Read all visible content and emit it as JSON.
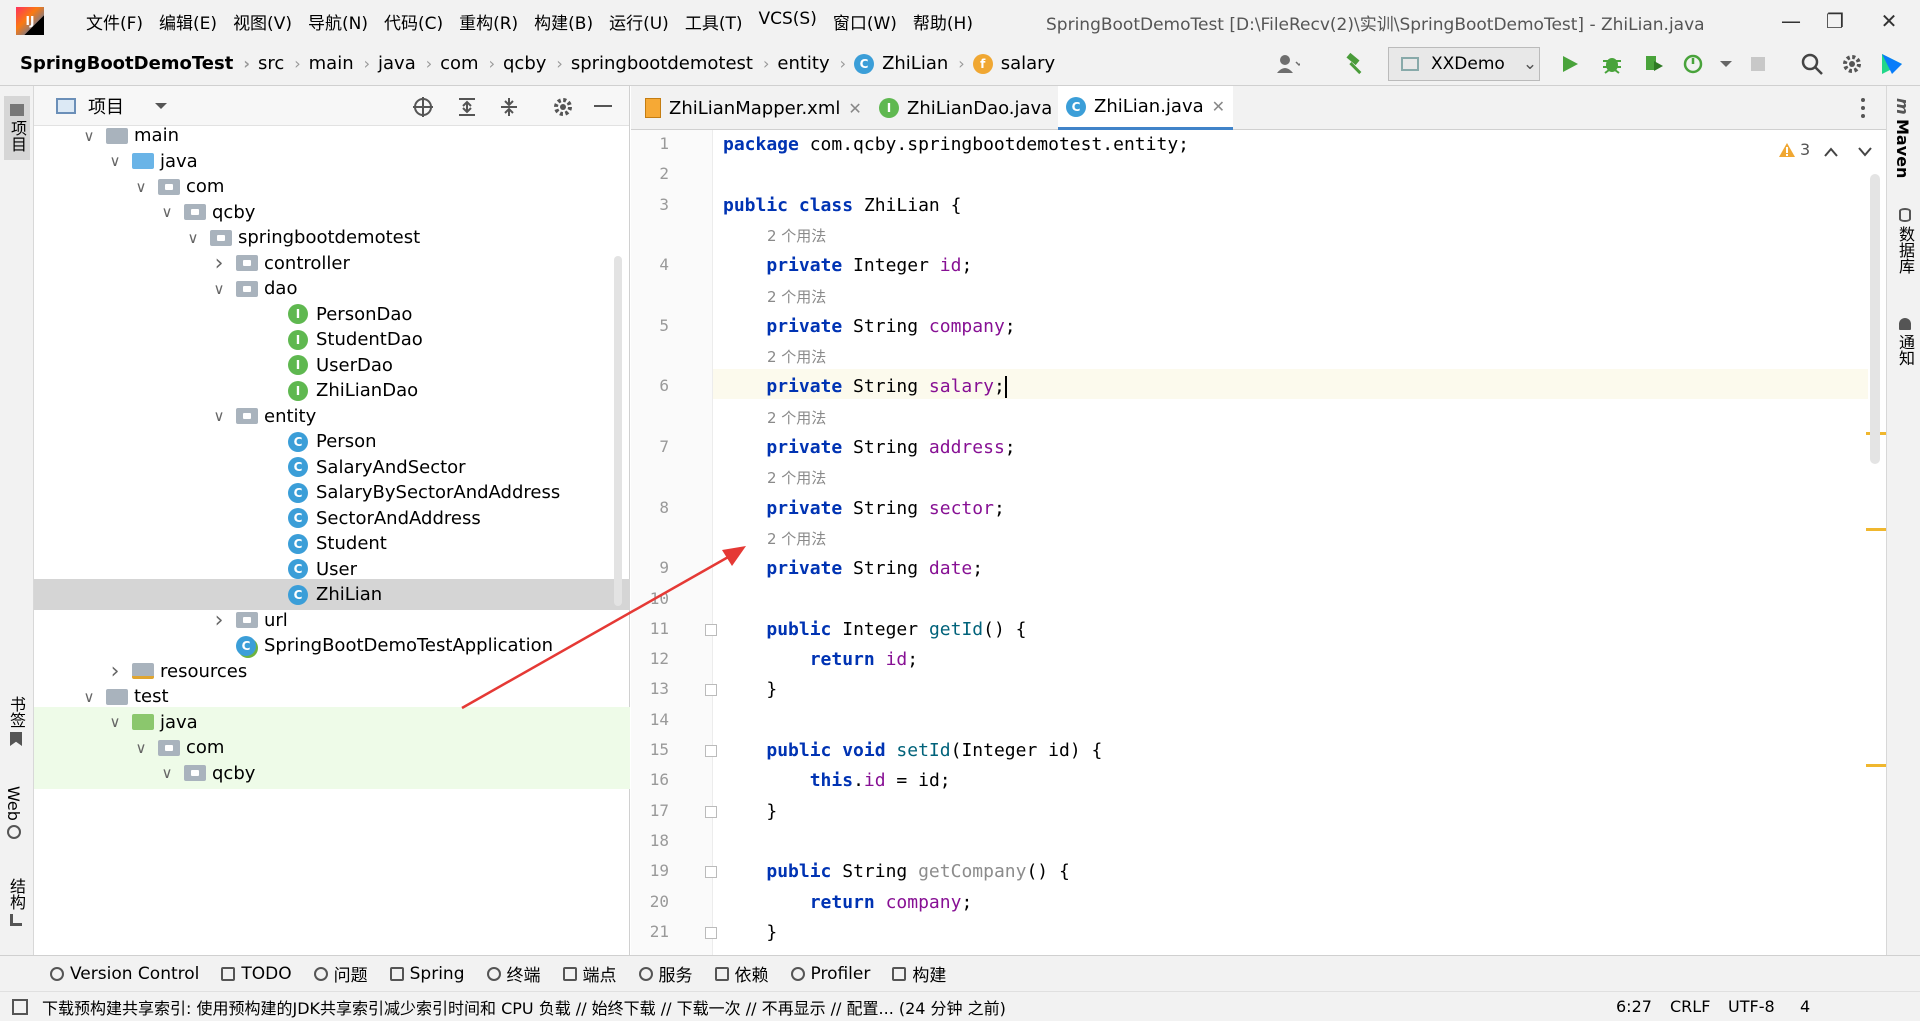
{
  "app": {
    "logo_text": "IJ"
  },
  "menu": [
    "文件(F)",
    "编辑(E)",
    "视图(V)",
    "导航(N)",
    "代码(C)",
    "重构(R)",
    "构建(B)",
    "运行(U)",
    "工具(T)",
    "VCS(S)",
    "窗口(W)",
    "帮助(H)"
  ],
  "window_title": "SpringBootDemoTest [D:\\FileRecv(2)\\实训\\SpringBootDemoTest] - ZhiLian.java",
  "breadcrumb": {
    "project": "SpringBootDemoTest",
    "items": [
      "src",
      "main",
      "java",
      "com",
      "qcby",
      "springbootdemotest",
      "entity"
    ],
    "class_name": "ZhiLian",
    "field_name": "salary"
  },
  "run_config": "XXDemo",
  "left_tabs": {
    "project": "项目",
    "bookmarks": "书签",
    "web": "Web",
    "structure": "结构"
  },
  "right_tabs": {
    "maven": "Maven",
    "database": "数据库",
    "notifications": "通知"
  },
  "project_panel": {
    "title": "项目"
  },
  "tree": [
    {
      "label": "main",
      "indent": 0,
      "type": "folder-plain",
      "expanded": true
    },
    {
      "label": "java",
      "indent": 1,
      "type": "folder-src",
      "expanded": true
    },
    {
      "label": "com",
      "indent": 2,
      "type": "folder-pkg",
      "expanded": true
    },
    {
      "label": "qcby",
      "indent": 3,
      "type": "folder-pkg",
      "expanded": true
    },
    {
      "label": "springbootdemotest",
      "indent": 4,
      "type": "folder-pkg",
      "expanded": true
    },
    {
      "label": "controller",
      "indent": 5,
      "type": "folder-pkg",
      "expanded": false
    },
    {
      "label": "dao",
      "indent": 5,
      "type": "folder-pkg",
      "expanded": true
    },
    {
      "label": "PersonDao",
      "indent": 6,
      "type": "interface"
    },
    {
      "label": "StudentDao",
      "indent": 6,
      "type": "interface"
    },
    {
      "label": "UserDao",
      "indent": 6,
      "type": "interface"
    },
    {
      "label": "ZhiLianDao",
      "indent": 6,
      "type": "interface"
    },
    {
      "label": "entity",
      "indent": 5,
      "type": "folder-pkg",
      "expanded": true
    },
    {
      "label": "Person",
      "indent": 6,
      "type": "class"
    },
    {
      "label": "SalaryAndSector",
      "indent": 6,
      "type": "class"
    },
    {
      "label": "SalaryBySectorAndAddress",
      "indent": 6,
      "type": "class"
    },
    {
      "label": "SectorAndAddress",
      "indent": 6,
      "type": "class"
    },
    {
      "label": "Student",
      "indent": 6,
      "type": "class"
    },
    {
      "label": "User",
      "indent": 6,
      "type": "class"
    },
    {
      "label": "ZhiLian",
      "indent": 6,
      "type": "class",
      "selected": true
    },
    {
      "label": "url",
      "indent": 5,
      "type": "folder-pkg",
      "expanded": false
    },
    {
      "label": "SpringBootDemoTestApplication",
      "indent": 5,
      "type": "app"
    },
    {
      "label": "resources",
      "indent": 1,
      "type": "folder-res",
      "expanded": false
    },
    {
      "label": "test",
      "indent": 0,
      "type": "folder-plain",
      "expanded": true
    },
    {
      "label": "java",
      "indent": 1,
      "type": "folder-test",
      "expanded": true,
      "green": true
    },
    {
      "label": "com",
      "indent": 2,
      "type": "folder-pkg",
      "expanded": true,
      "green": true
    },
    {
      "label": "qcby",
      "indent": 3,
      "type": "folder-pkg",
      "expanded": true,
      "green": true
    }
  ],
  "editor_tabs": [
    {
      "label": "ZhiLianMapper.xml",
      "icon": "xml"
    },
    {
      "label": "ZhiLianDao.java",
      "icon": "interface"
    },
    {
      "label": "ZhiLian.java",
      "icon": "class",
      "active": true
    }
  ],
  "warnings_count": "3",
  "usage_hint": "2 个用法",
  "code_lines": [
    {
      "n": "1",
      "tokens": [
        [
          "kw",
          "package"
        ],
        [
          "",
          " com.qcby.springbootdemotest.entity;"
        ]
      ]
    },
    {
      "n": "2",
      "tokens": []
    },
    {
      "n": "3",
      "tokens": [
        [
          "kw",
          "public class"
        ],
        [
          "",
          " ZhiLian {"
        ]
      ]
    },
    {
      "n": "4",
      "hint": true,
      "tokens": [
        [
          "",
          "    "
        ],
        [
          "kw",
          "private"
        ],
        [
          "",
          " Integer "
        ],
        [
          "fld",
          "id"
        ],
        [
          "",
          ";"
        ]
      ]
    },
    {
      "n": "5",
      "hint": true,
      "tokens": [
        [
          "",
          "    "
        ],
        [
          "kw",
          "private"
        ],
        [
          "",
          " String "
        ],
        [
          "fld",
          "company"
        ],
        [
          "",
          ";"
        ]
      ]
    },
    {
      "n": "6",
      "hint": true,
      "current": true,
      "tokens": [
        [
          "",
          "    "
        ],
        [
          "kw",
          "private"
        ],
        [
          "",
          " String "
        ],
        [
          "fld",
          "salary"
        ],
        [
          "",
          ";"
        ]
      ]
    },
    {
      "n": "7",
      "hint": true,
      "tokens": [
        [
          "",
          "    "
        ],
        [
          "kw",
          "private"
        ],
        [
          "",
          " String "
        ],
        [
          "fld",
          "address"
        ],
        [
          "",
          ";"
        ]
      ]
    },
    {
      "n": "8",
      "hint": true,
      "tokens": [
        [
          "",
          "    "
        ],
        [
          "kw",
          "private"
        ],
        [
          "",
          " String "
        ],
        [
          "fld",
          "sector"
        ],
        [
          "",
          ";"
        ]
      ]
    },
    {
      "n": "9",
      "hint": true,
      "tokens": [
        [
          "",
          "    "
        ],
        [
          "kw",
          "private"
        ],
        [
          "",
          " String "
        ],
        [
          "fld",
          "date"
        ],
        [
          "",
          ";"
        ]
      ]
    },
    {
      "n": "10",
      "tokens": []
    },
    {
      "n": "11",
      "fold": true,
      "tokens": [
        [
          "",
          "    "
        ],
        [
          "kw",
          "public"
        ],
        [
          "",
          " Integer "
        ],
        [
          "mth",
          "getId"
        ],
        [
          "",
          "() {"
        ]
      ]
    },
    {
      "n": "12",
      "tokens": [
        [
          "",
          "        "
        ],
        [
          "kw",
          "return"
        ],
        [
          "",
          " "
        ],
        [
          "fld",
          "id"
        ],
        [
          "",
          ";"
        ]
      ]
    },
    {
      "n": "13",
      "fold": true,
      "tokens": [
        [
          "",
          "    }"
        ]
      ]
    },
    {
      "n": "14",
      "tokens": []
    },
    {
      "n": "15",
      "fold": true,
      "tokens": [
        [
          "",
          "    "
        ],
        [
          "kw",
          "public void"
        ],
        [
          "",
          " "
        ],
        [
          "mth",
          "setId"
        ],
        [
          "",
          "(Integer id) {"
        ]
      ]
    },
    {
      "n": "16",
      "tokens": [
        [
          "",
          "        "
        ],
        [
          "kw",
          "this"
        ],
        [
          "",
          "."
        ],
        [
          "fld",
          "id"
        ],
        [
          "",
          " = id;"
        ]
      ]
    },
    {
      "n": "17",
      "fold": true,
      "tokens": [
        [
          "",
          "    }"
        ]
      ]
    },
    {
      "n": "18",
      "tokens": []
    },
    {
      "n": "19",
      "fold": true,
      "tokens": [
        [
          "",
          "    "
        ],
        [
          "kw",
          "public"
        ],
        [
          "",
          " String "
        ],
        [
          "gray",
          "getCompany"
        ],
        [
          "",
          "() {"
        ]
      ]
    },
    {
      "n": "20",
      "tokens": [
        [
          "",
          "        "
        ],
        [
          "kw",
          "return"
        ],
        [
          "",
          " "
        ],
        [
          "fld",
          "company"
        ],
        [
          "",
          ";"
        ]
      ]
    },
    {
      "n": "21",
      "fold": true,
      "tokens": [
        [
          "",
          "    }"
        ]
      ]
    }
  ],
  "tool_windows": [
    "Version Control",
    "TODO",
    "问题",
    "Spring",
    "终端",
    "端点",
    "服务",
    "依赖",
    "Profiler",
    "构建"
  ],
  "status": {
    "message": "下载预构建共享索引: 使用预构建的JDK共享索引减少索引时间和 CPU 负载 // 始终下载 // 下载一次 // 不再显示 // 配置... (24 分钟 之前)",
    "position": "6:27",
    "line_sep": "CRLF",
    "encoding": "UTF-8",
    "indent": "4"
  },
  "colors": {
    "keyword": "#0033b3",
    "field": "#871094",
    "method": "#00627a",
    "accent": "#4083c9",
    "arrow": "#e53935"
  }
}
